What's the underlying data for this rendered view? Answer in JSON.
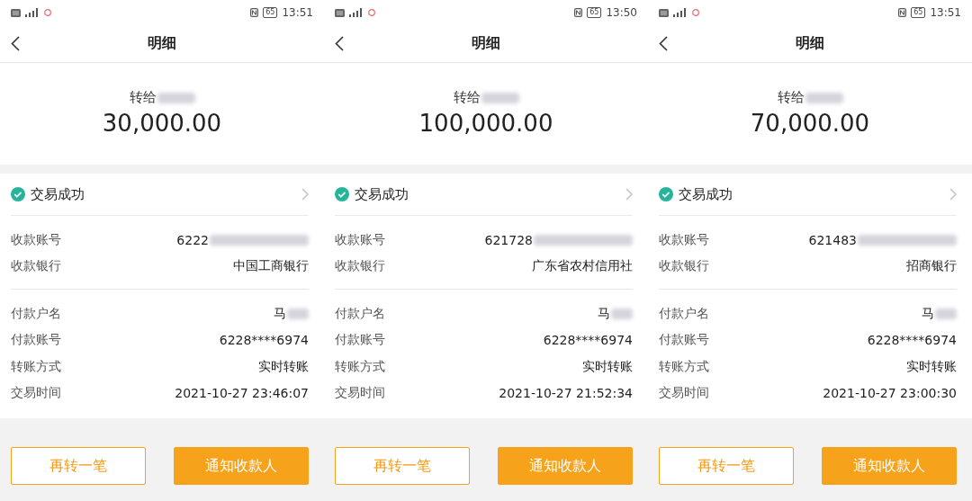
{
  "screens": [
    {
      "status_bar": {
        "battery": "65",
        "time": "13:51"
      },
      "title": "明细",
      "summary": {
        "label": "转给",
        "payee_redacted": true,
        "amount": "30,000.00"
      },
      "status": {
        "text": "交易成功",
        "success": true
      },
      "groups": [
        [
          {
            "label": "收款账号",
            "value": "6222",
            "redacted": true
          },
          {
            "label": "收款银行",
            "value": "中国工商银行",
            "redacted": false
          }
        ],
        [
          {
            "label": "付款户名",
            "value": "马",
            "redacted": true
          },
          {
            "label": "付款账号",
            "value": "6228****6974",
            "redacted": false
          },
          {
            "label": "转账方式",
            "value": "实时转账",
            "redacted": false
          },
          {
            "label": "交易时间",
            "value": "2021-10-27 23:46:07",
            "redacted": false
          }
        ]
      ],
      "buttons": [
        {
          "label": "再转一笔",
          "kind": "outline"
        },
        {
          "label": "通知收款人",
          "kind": "primary"
        }
      ]
    },
    {
      "status_bar": {
        "battery": "65",
        "time": "13:50"
      },
      "title": "明细",
      "summary": {
        "label": "转给",
        "payee_redacted": true,
        "amount": "100,000.00"
      },
      "status": {
        "text": "交易成功",
        "success": true
      },
      "groups": [
        [
          {
            "label": "收款账号",
            "value": "621728",
            "redacted": true
          },
          {
            "label": "收款银行",
            "value": "广东省农村信用社",
            "redacted": false
          }
        ],
        [
          {
            "label": "付款户名",
            "value": "马",
            "redacted": true
          },
          {
            "label": "付款账号",
            "value": "6228****6974",
            "redacted": false
          },
          {
            "label": "转账方式",
            "value": "实时转账",
            "redacted": false
          },
          {
            "label": "交易时间",
            "value": "2021-10-27 21:52:34",
            "redacted": false
          }
        ]
      ],
      "buttons": [
        {
          "label": "再转一笔",
          "kind": "outline"
        },
        {
          "label": "通知收款人",
          "kind": "primary"
        }
      ]
    },
    {
      "status_bar": {
        "battery": "65",
        "time": "13:51"
      },
      "title": "明细",
      "summary": {
        "label": "转给",
        "payee_redacted": true,
        "amount": "70,000.00"
      },
      "status": {
        "text": "交易成功",
        "success": true
      },
      "groups": [
        [
          {
            "label": "收款账号",
            "value": "621483",
            "redacted": true
          },
          {
            "label": "收款银行",
            "value": "招商银行",
            "redacted": false
          }
        ],
        [
          {
            "label": "付款户名",
            "value": "马",
            "redacted": true
          },
          {
            "label": "付款账号",
            "value": "6228****6974",
            "redacted": false
          },
          {
            "label": "转账方式",
            "value": "实时转账",
            "redacted": false
          },
          {
            "label": "交易时间",
            "value": "2021-10-27 23:00:30",
            "redacted": false
          }
        ]
      ],
      "buttons": [
        {
          "label": "再转一笔",
          "kind": "outline"
        },
        {
          "label": "通知收款人",
          "kind": "primary"
        }
      ]
    }
  ]
}
